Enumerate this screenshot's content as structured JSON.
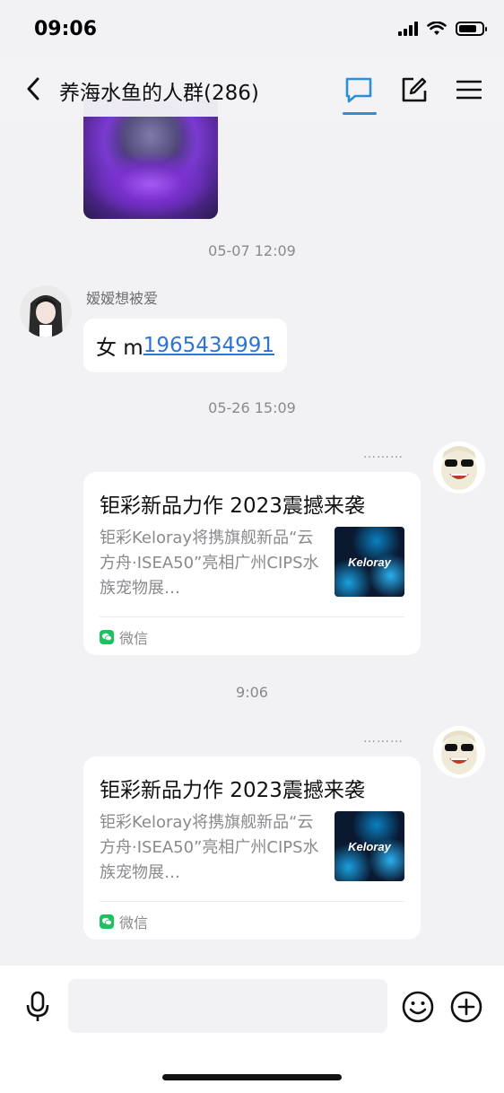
{
  "status_bar": {
    "time": "09:06"
  },
  "header": {
    "title": "养海水鱼的人群(286)"
  },
  "messages": {
    "ts1": "05-07 12:09",
    "msg1": {
      "sender": "嫒嫒想被爱",
      "prefix": "女 m",
      "link": "1965434991"
    },
    "ts2": "05-26 15:09",
    "card1": {
      "title": "钜彩新品力作 2023震撼来袭",
      "desc": "钜彩Keloray将携旗舰新品“云方舟·ISEA50”亮相广州CIPS水族宠物展…",
      "thumb_text": "Keloray",
      "source": "微信"
    },
    "ts3": "9:06",
    "card2": {
      "title": "钜彩新品力作 2023震撼来袭",
      "desc": "钜彩Keloray将携旗舰新品“云方舟·ISEA50”亮相广州CIPS水族宠物展…",
      "thumb_text": "Keloray",
      "source": "微信"
    },
    "dots": "………"
  },
  "input_bar": {
    "placeholder": ""
  },
  "colors": {
    "accent": "#2a8fd9",
    "link": "#2e74d1",
    "wechat_green": "#1ec15f"
  },
  "icons": [
    "back-icon",
    "chat-icon",
    "edit-icon",
    "menu-icon",
    "mic-icon",
    "emoji-icon",
    "plus-icon",
    "wechat-icon"
  ]
}
